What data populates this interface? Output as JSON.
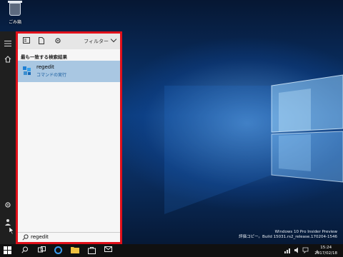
{
  "desktop": {
    "recycle_bin_label": "ごみ箱"
  },
  "search_panel": {
    "filter_label": "フィルター",
    "section_title": "最も一致する検索結果",
    "best_match": {
      "name": "regedit",
      "subtitle": "コマンドの実行"
    },
    "query": "regedit",
    "border_color": "#e0101a"
  },
  "watermark": {
    "line1": "Windows 10 Pro Insider Preview",
    "line2": "評価コピー。Build 15031.rs2_release.170204-1546"
  },
  "taskbar": {
    "time": "15:24",
    "date": "2017/02/18",
    "ime": "A"
  },
  "icons": [
    "recycle-bin-icon",
    "hamburger-icon",
    "home-icon",
    "settings-icon",
    "user-icon",
    "cursor-icon",
    "document-icon",
    "app-icon",
    "search-icon",
    "start-icon",
    "cortana-icon",
    "task-view-icon",
    "edge-icon",
    "file-explorer-icon",
    "store-icon",
    "mail-icon",
    "network-icon",
    "volume-icon",
    "notification-icon"
  ]
}
